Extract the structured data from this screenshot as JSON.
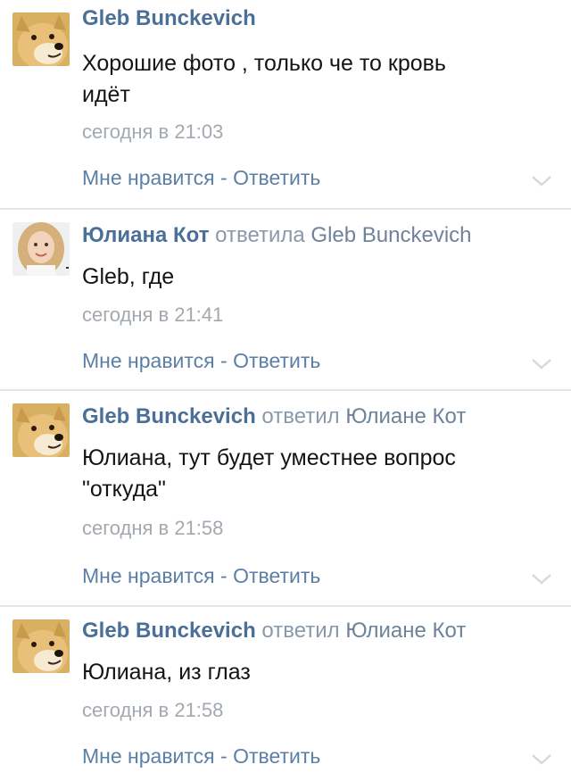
{
  "comments": [
    {
      "author": "Gleb Bunckevich",
      "reply_word": "",
      "reply_to": "",
      "text_lines": [
        "Хорошие фото , только че то кровь",
        "идёт"
      ],
      "time": "сегодня в 21:03",
      "like_label": "Мне нравится",
      "separator": " - ",
      "reply_label": "Ответить",
      "avatar_icon": "doge-avatar"
    },
    {
      "author": "Юлиана Кот",
      "reply_word": "ответила",
      "reply_to": "Gleb Bunckevich",
      "text_lines": [
        "Gleb, где"
      ],
      "time": "сегодня в 21:41",
      "like_label": "Мне нравится",
      "separator": " - ",
      "reply_label": "Ответить",
      "avatar_icon": "girl-photo-avatar"
    },
    {
      "author": "Gleb Bunckevich",
      "reply_word": "ответил",
      "reply_to": "Юлиане Кот",
      "text_lines": [
        "Юлиана, тут будет уместнее вопрос",
        "\"откуда\""
      ],
      "time": "сегодня в 21:58",
      "like_label": "Мне нравится",
      "separator": " - ",
      "reply_label": "Ответить",
      "avatar_icon": "doge-avatar"
    },
    {
      "author": "Gleb Bunckevich",
      "reply_word": "ответил",
      "reply_to": "Юлиане Кот",
      "text_lines": [
        "Юлиана, из глаз"
      ],
      "time": "сегодня в 21:58",
      "like_label": "Мне нравится",
      "separator": " - ",
      "reply_label": "Ответить",
      "avatar_icon": "doge-avatar"
    }
  ],
  "colors": {
    "author": "#4a6f98",
    "link": "#5b7fa6",
    "muted": "#a3a9b1",
    "text": "#141414",
    "divider": "#e3e6ea"
  }
}
